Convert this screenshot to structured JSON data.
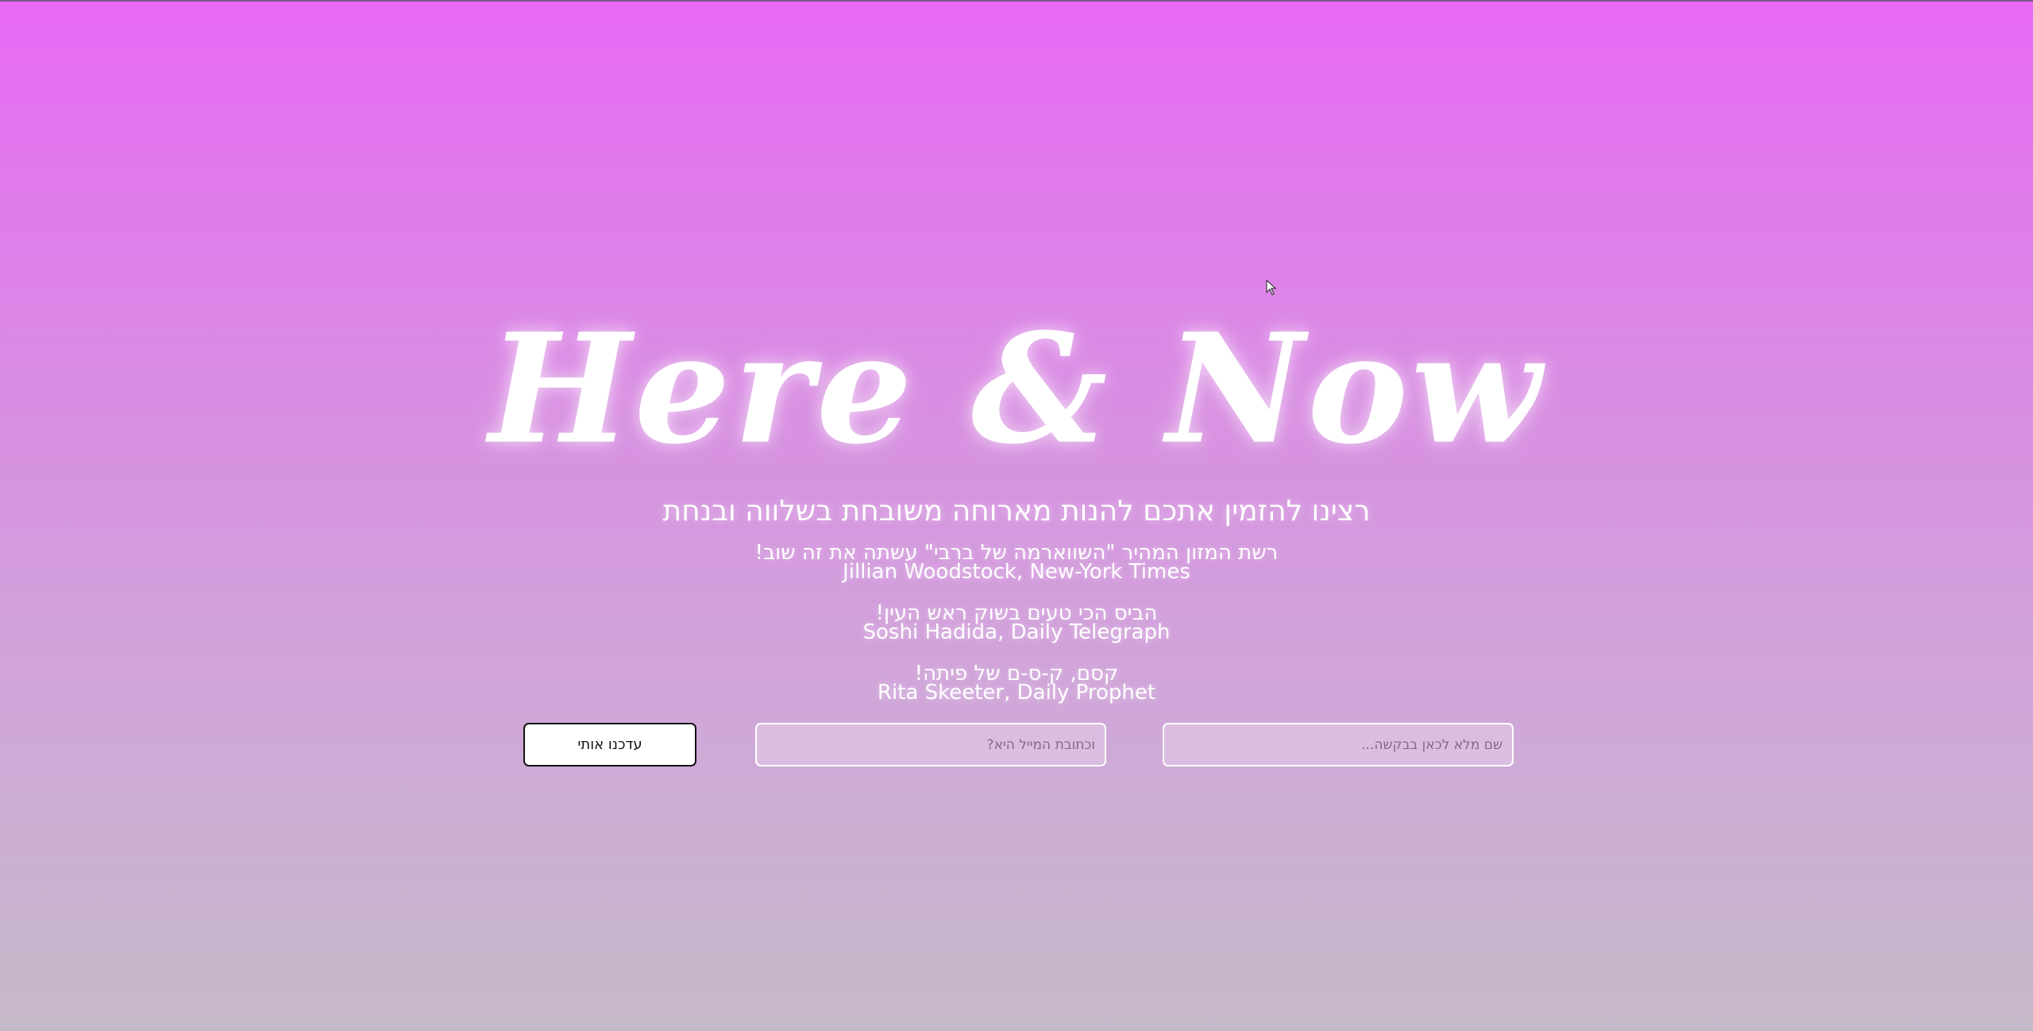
{
  "hero": {
    "logo": "Here & Now",
    "tagline": "רצינו להזמין אתכם להנות מארוחה משובחת בשלווה ובנחת"
  },
  "reviews": [
    {
      "quote": "רשת המזון המהיר \"השווארמה של ברבי\" עשתה את זה שוב!",
      "author": "Jillian Woodstock, New-York Times"
    },
    {
      "quote": "הביס הכי טעים בשוק ראש העין!",
      "author": "Soshi Hadida, Daily Telegraph"
    },
    {
      "quote": "קסם, ק-ס-ם של פיתה!",
      "author": "Rita Skeeter, Daily Prophet"
    }
  ],
  "form": {
    "name_placeholder": "שם מלא לכאן בבקשה...",
    "email_placeholder": "וכתובת המייל היא?",
    "submit_label": "עדכנו אותי"
  },
  "colors": {
    "gradient_top": "#e869f5",
    "gradient_bottom": "#c5b9c8",
    "text": "#ffffff",
    "button_bg": "#ffffff",
    "button_border": "#111111"
  },
  "icons": {
    "cursor": "mouse-pointer-icon"
  }
}
